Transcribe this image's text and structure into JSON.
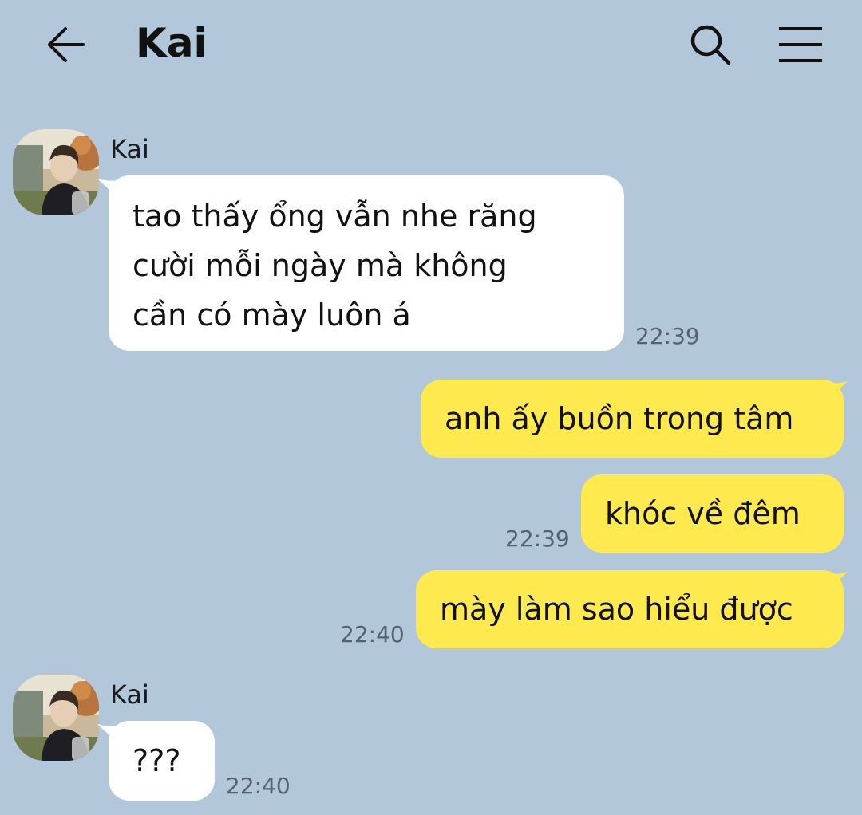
{
  "header": {
    "title": "Kai",
    "back_icon": "arrow-left-icon",
    "search_icon": "search-icon",
    "menu_icon": "hamburger-menu-icon"
  },
  "colors": {
    "background": "#b2c7d9",
    "incoming_bubble": "#ffffff",
    "outgoing_bubble": "#fee94f",
    "timestamp": "#556170"
  },
  "messages": [
    {
      "sender": "Kai",
      "lines": [
        "tao thấy ổng vẫn nhe răng",
        "cười mỗi ngày mà không",
        "cần có mày luôn á"
      ],
      "time": "22:39"
    },
    {
      "text": "anh ấy buồn trong tâm"
    },
    {
      "text": "khóc về đêm",
      "time": "22:39"
    },
    {
      "text": "mày làm sao hiểu được",
      "time": "22:40"
    },
    {
      "sender": "Kai",
      "lines": [
        "???"
      ],
      "time": "22:40"
    }
  ]
}
